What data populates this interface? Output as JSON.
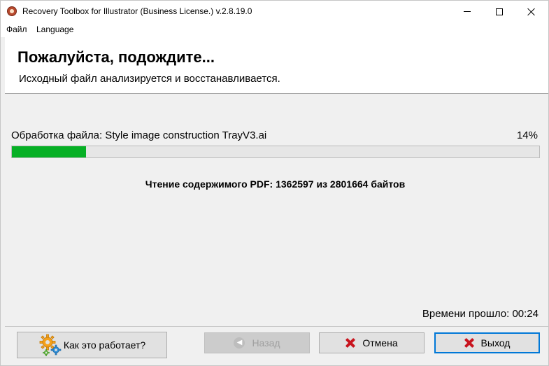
{
  "window": {
    "title": "Recovery Toolbox for Illustrator (Business License.) v.2.8.19.0"
  },
  "menu": {
    "items": [
      "Файл",
      "Language"
    ]
  },
  "header": {
    "title": "Пожалуйста, подождите...",
    "subtitle": "Исходный файл анализируется и восстанавливается."
  },
  "progress": {
    "file_label": "Обработка файла: Style image construction TrayV3.ai",
    "percent_text": "14%",
    "percent": 14,
    "status": "Чтение содержимого PDF: 1362597 из 2801664 байтов",
    "elapsed": "Времени прошло: 00:24"
  },
  "buttons": {
    "help": "Как это работает?",
    "back": "Назад",
    "cancel": "Отмена",
    "exit": "Выход"
  },
  "colors": {
    "progress_fill": "#06b025",
    "close_icon": "#c8141e",
    "focus_border": "#0078d7"
  }
}
